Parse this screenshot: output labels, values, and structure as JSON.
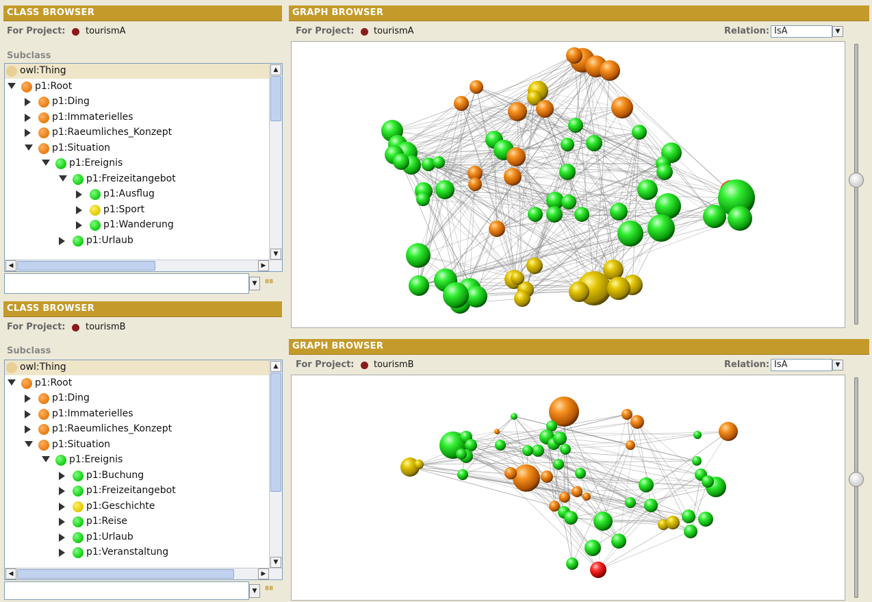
{
  "class_browser_a": {
    "title": "CLASS BROWSER",
    "for_project_label": "For Project:",
    "project_name": "tourismA",
    "subclass_label": "Subclass",
    "tree": [
      {
        "label": "owl:Thing",
        "color": "beige",
        "indent": 0,
        "arrow": "none",
        "selected": true
      },
      {
        "label": "p1:Root",
        "color": "orange",
        "indent": 0,
        "arrow": "down"
      },
      {
        "label": "p1:Ding",
        "color": "orange",
        "indent": 1,
        "arrow": "right"
      },
      {
        "label": "p1:Immaterielles",
        "color": "orange",
        "indent": 1,
        "arrow": "right"
      },
      {
        "label": "p1:Raeumliches_Konzept",
        "color": "orange",
        "indent": 1,
        "arrow": "right"
      },
      {
        "label": "p1:Situation",
        "color": "orange",
        "indent": 1,
        "arrow": "down"
      },
      {
        "label": "p1:Ereignis",
        "color": "green",
        "indent": 2,
        "arrow": "down"
      },
      {
        "label": "p1:Freizeitangebot",
        "color": "green",
        "indent": 3,
        "arrow": "down"
      },
      {
        "label": "p1:Ausflug",
        "color": "green",
        "indent": 4,
        "arrow": "right"
      },
      {
        "label": "p1:Sport",
        "color": "yellow",
        "indent": 4,
        "arrow": "right"
      },
      {
        "label": "p1:Wanderung",
        "color": "green",
        "indent": 4,
        "arrow": "right"
      },
      {
        "label": "p1:Urlaub",
        "color": "green",
        "indent": 3,
        "arrow": "right"
      }
    ]
  },
  "class_browser_b": {
    "title": "CLASS BROWSER",
    "for_project_label": "For Project:",
    "project_name": "tourismB",
    "subclass_label": "Subclass",
    "tree": [
      {
        "label": "owl:Thing",
        "color": "beige",
        "indent": 0,
        "arrow": "none",
        "selected": true
      },
      {
        "label": "p1:Root",
        "color": "orange",
        "indent": 0,
        "arrow": "down"
      },
      {
        "label": "p1:Ding",
        "color": "orange",
        "indent": 1,
        "arrow": "right"
      },
      {
        "label": "p1:Immaterielles",
        "color": "orange",
        "indent": 1,
        "arrow": "right"
      },
      {
        "label": "p1:Raeumliches_Konzept",
        "color": "orange",
        "indent": 1,
        "arrow": "right"
      },
      {
        "label": "p1:Situation",
        "color": "orange",
        "indent": 1,
        "arrow": "down"
      },
      {
        "label": "p1:Ereignis",
        "color": "green",
        "indent": 2,
        "arrow": "down"
      },
      {
        "label": "p1:Buchung",
        "color": "green",
        "indent": 3,
        "arrow": "right"
      },
      {
        "label": "p1:Freizeitangebot",
        "color": "green",
        "indent": 3,
        "arrow": "right"
      },
      {
        "label": "p1:Geschichte",
        "color": "yellow",
        "indent": 3,
        "arrow": "right"
      },
      {
        "label": "p1:Reise",
        "color": "green",
        "indent": 3,
        "arrow": "right"
      },
      {
        "label": "p1:Urlaub",
        "color": "green",
        "indent": 3,
        "arrow": "right"
      },
      {
        "label": "p1:Veranstaltung",
        "color": "green",
        "indent": 3,
        "arrow": "right"
      }
    ]
  },
  "graph_browser_a": {
    "title": "GRAPH BROWSER",
    "for_project_label": "For Project:",
    "project_name": "tourismA",
    "relation_label": "Relation:",
    "relation_value": "IsA"
  },
  "graph_browser_b": {
    "title": "GRAPH BROWSER",
    "for_project_label": "For Project:",
    "project_name": "tourismB",
    "relation_label": "Relation:",
    "relation_value": "IsA"
  },
  "colors": {
    "header": "#c49a2a",
    "orange": "#e87b10",
    "green": "#10cc10",
    "yellow": "#e0c800",
    "red": "#e02020",
    "project_dot": "#8b1a1a"
  },
  "icons": {
    "search": "binoculars-icon",
    "expand": "triangle-right-icon",
    "collapse": "triangle-down-icon"
  }
}
